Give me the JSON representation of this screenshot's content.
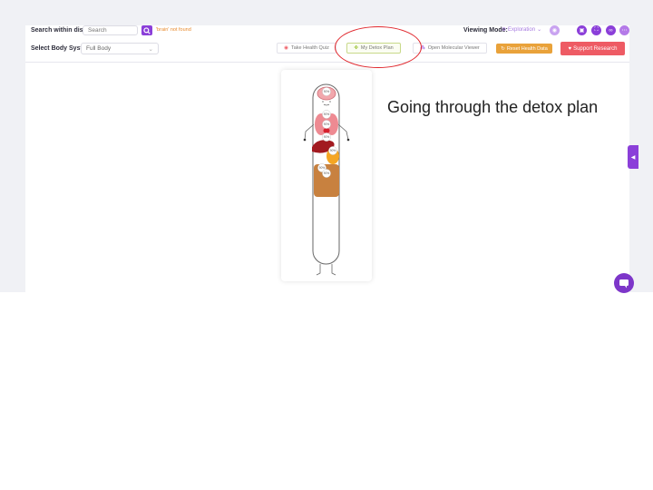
{
  "toolbar": {
    "search_label": "Search within display",
    "search_placeholder": "Search",
    "search_status": "'brain' not found",
    "body_system_label": "Select Body System:",
    "body_system_value": "Full Body",
    "buttons": {
      "health_quiz": "Take Health Quiz",
      "detox_plan": "My Detox Plan",
      "molecular_viewer": "Open Molecular Viewer",
      "reset_health_data": "Reset Health Data",
      "support_research": "Support Research"
    },
    "viewing_mode_label": "Viewing Mode:",
    "viewing_mode_value": "Exploration"
  },
  "body_diagram": {
    "organ_labels": [
      "90%",
      "90%",
      "90%",
      "90%",
      "90%",
      "90%",
      "90%"
    ]
  },
  "annotation": "Going through the detox plan",
  "colors": {
    "accent_purple": "#8b3fd9",
    "detox_button_border": "#c8d98a",
    "reset_button": "#e9a23a",
    "support_button": "#ee5b64",
    "highlight_oval": "#e0262c"
  }
}
